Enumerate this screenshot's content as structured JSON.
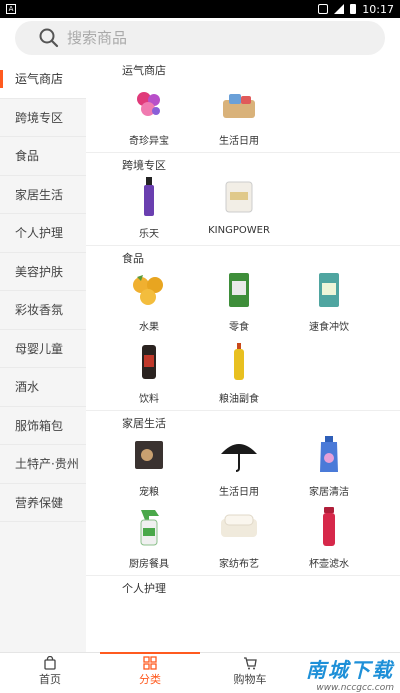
{
  "status_bar": {
    "time": "10:17",
    "notif_icon": "A"
  },
  "search": {
    "placeholder": "搜索商品"
  },
  "sidebar": {
    "items": [
      {
        "label": "运气商店"
      },
      {
        "label": "跨境专区"
      },
      {
        "label": "食品"
      },
      {
        "label": "家居生活"
      },
      {
        "label": "个人护理"
      },
      {
        "label": "美容护肤"
      },
      {
        "label": "彩妆香氛"
      },
      {
        "label": "母婴儿童"
      },
      {
        "label": "酒水"
      },
      {
        "label": "服饰箱包"
      },
      {
        "label": "土特产·贵州"
      },
      {
        "label": "营养保健"
      }
    ]
  },
  "sections": [
    {
      "title": "运气商店",
      "items": [
        {
          "label": "奇珍异宝"
        },
        {
          "label": "生活日用"
        }
      ]
    },
    {
      "title": "跨境专区",
      "items": [
        {
          "label": "乐天"
        },
        {
          "label": "KINGPOWER"
        }
      ]
    },
    {
      "title": "食品",
      "items": [
        {
          "label": "水果"
        },
        {
          "label": "零食"
        },
        {
          "label": "速食冲饮"
        },
        {
          "label": "饮料"
        },
        {
          "label": "粮油副食"
        }
      ]
    },
    {
      "title": "家居生活",
      "items": [
        {
          "label": "宠粮"
        },
        {
          "label": "生活日用"
        },
        {
          "label": "家居清洁"
        },
        {
          "label": "厨房餐具"
        },
        {
          "label": "家纺布艺"
        },
        {
          "label": "杯壶滤水"
        }
      ]
    },
    {
      "title": "个人护理",
      "items": []
    }
  ],
  "tabbar": {
    "home": "首页",
    "category": "分类",
    "cart": "购物车"
  },
  "watermark": {
    "main": "南城下载",
    "sub": "www.nccgcc.com"
  },
  "colors": {
    "accent": "#ff5a1f"
  }
}
